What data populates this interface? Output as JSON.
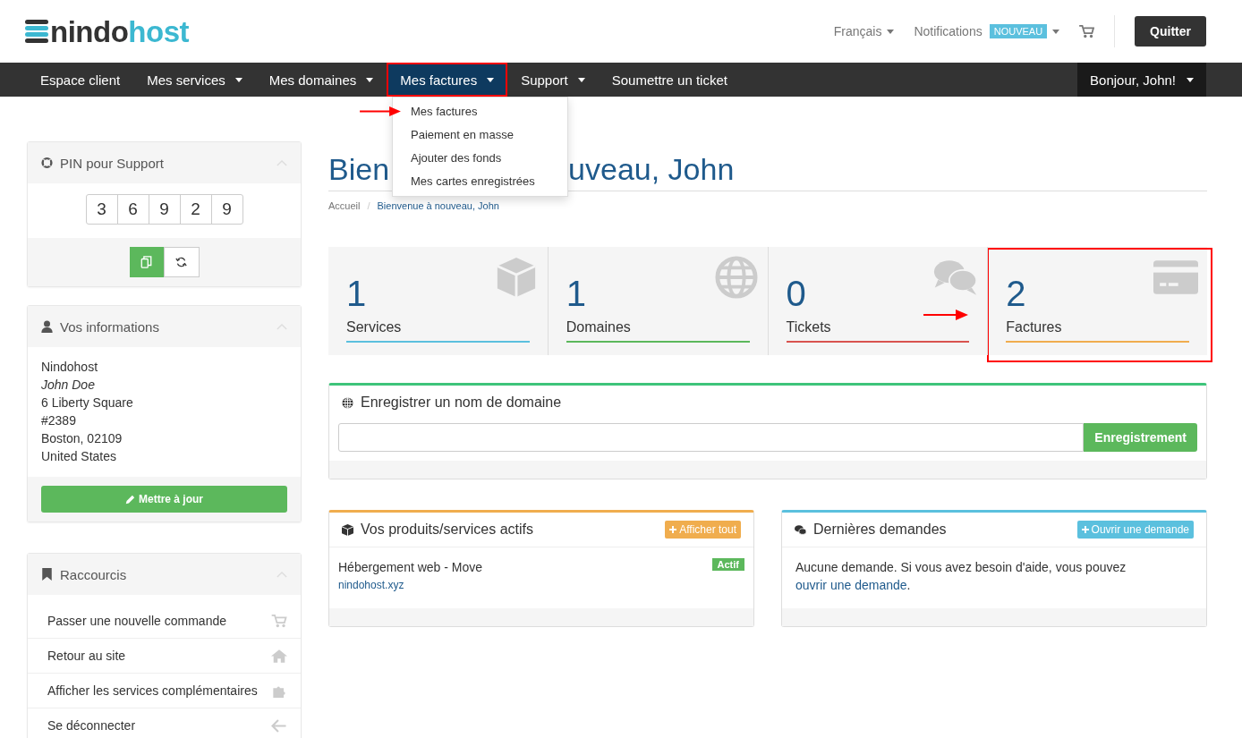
{
  "header": {
    "logo": {
      "first": "nindo",
      "second": "host"
    },
    "language": "Français",
    "notifications": {
      "label": "Notifications",
      "badge": "NOUVEAU"
    },
    "logout": "Quitter"
  },
  "nav": {
    "items": [
      {
        "label": "Espace client",
        "dropdown": false,
        "selected": false,
        "highlighted": false
      },
      {
        "label": "Mes services",
        "dropdown": true,
        "selected": false,
        "highlighted": false
      },
      {
        "label": "Mes domaines",
        "dropdown": true,
        "selected": false,
        "highlighted": false
      },
      {
        "label": "Mes factures",
        "dropdown": true,
        "selected": true,
        "highlighted": true
      },
      {
        "label": "Support",
        "dropdown": true,
        "selected": false,
        "highlighted": false
      },
      {
        "label": "Soumettre un ticket",
        "dropdown": false,
        "selected": false,
        "highlighted": false
      }
    ],
    "user": "Bonjour, John!"
  },
  "dropdown": {
    "items": [
      {
        "label": "Mes factures",
        "arrow": true
      },
      {
        "label": "Paiement en masse",
        "arrow": false
      },
      {
        "label": "Ajouter des fonds",
        "arrow": false
      },
      {
        "label": "Mes cartes enregistrées",
        "arrow": false
      }
    ]
  },
  "sidebar": {
    "pin": {
      "title": "PIN pour Support",
      "digits": [
        "3",
        "6",
        "9",
        "2",
        "9"
      ]
    },
    "info": {
      "title": "Vos informations",
      "lines": [
        {
          "text": "Nindohost",
          "italic": false
        },
        {
          "text": "John Doe",
          "italic": true
        },
        {
          "text": "6 Liberty Square",
          "italic": false
        },
        {
          "text": "#2389",
          "italic": false
        },
        {
          "text": "Boston, 02109",
          "italic": false
        },
        {
          "text": "United States",
          "italic": false
        }
      ],
      "button": "Mettre à jour"
    },
    "shortcuts": {
      "title": "Raccourcis",
      "items": [
        {
          "label": "Passer une nouvelle commande",
          "kind": "cart"
        },
        {
          "label": "Retour au site",
          "kind": "home"
        },
        {
          "label": "Afficher les services complémentaires",
          "kind": "puzzle"
        },
        {
          "label": "Se déconnecter",
          "kind": "arrow"
        }
      ]
    }
  },
  "main": {
    "title_parts": [
      "Bien",
      "uveau, John"
    ],
    "breadcrumb": [
      {
        "label": "Accueil",
        "current": false
      },
      {
        "label": "Bienvenue à nouveau, John",
        "current": true
      }
    ],
    "breadcrumb_separator": "/",
    "stats": [
      {
        "count": "1",
        "label": "Services",
        "kind": "box",
        "color": "#5bc0de",
        "highlighted": false,
        "arrow": false
      },
      {
        "count": "1",
        "label": "Domaines",
        "kind": "globe",
        "color": "#5cb85c",
        "highlighted": false,
        "arrow": false
      },
      {
        "count": "0",
        "label": "Tickets",
        "kind": "chat",
        "color": "#d9534f",
        "highlighted": false,
        "arrow": true
      },
      {
        "count": "2",
        "label": "Factures",
        "kind": "card",
        "color": "#f0ad4e",
        "highlighted": true,
        "arrow": false
      }
    ],
    "domain_panel": {
      "title": "Enregistrer un nom de domaine",
      "button": "Enregistrement"
    },
    "products": {
      "title": "Vos produits/services actifs",
      "button": "Afficher tout",
      "items": [
        {
          "name": "Hébergement web - Move",
          "domain": "nindohost.xyz",
          "status": "Actif"
        }
      ]
    },
    "tickets": {
      "title": "Dernières demandes",
      "button": "Ouvrir une demande",
      "message": "Aucune demande. Si vous avez besoin d'aide, vous pouvez ",
      "link": "ouvrir une demande",
      "after": "."
    }
  }
}
